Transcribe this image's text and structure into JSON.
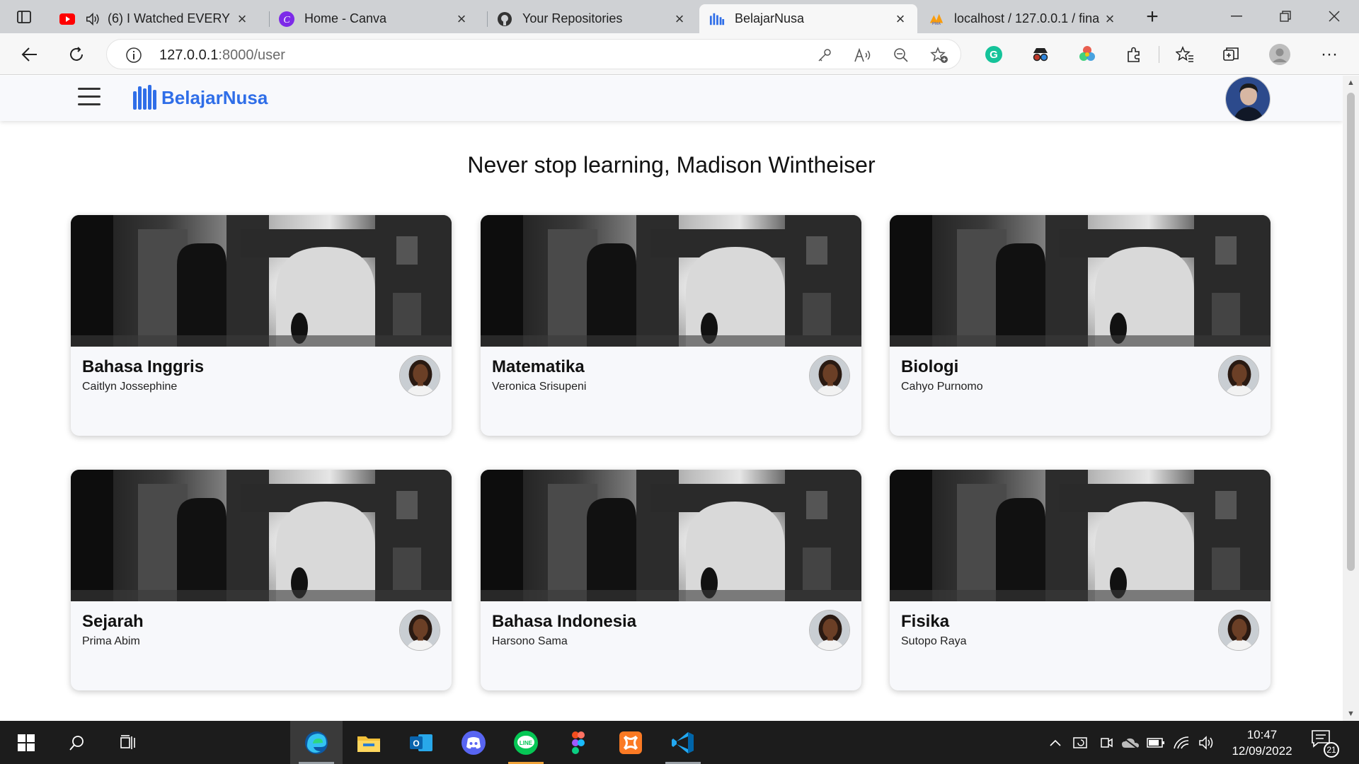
{
  "browser": {
    "tabs": [
      {
        "title": "(6) I Watched EVERY",
        "icon": "youtube-icon",
        "audio": true
      },
      {
        "title": "Home - Canva",
        "icon": "canva-icon"
      },
      {
        "title": "Your Repositories",
        "icon": "github-icon"
      },
      {
        "title": "BelajarNusa",
        "icon": "belajarnusa-icon",
        "active": true
      },
      {
        "title": "localhost / 127.0.0.1 / fina",
        "icon": "phpmyadmin-icon"
      }
    ],
    "url_host": "127.0.0.1",
    "url_rest": ":8000/user"
  },
  "navbar": {
    "brand": "BelajarNusa",
    "brand_color": "#2f6ee8"
  },
  "greeting": "Never stop learning, Madison Wintheiser",
  "courses": [
    {
      "title": "Bahasa Inggris",
      "teacher": "Caitlyn Jossephine"
    },
    {
      "title": "Matematika",
      "teacher": "Veronica Srisupeni"
    },
    {
      "title": "Biologi",
      "teacher": "Cahyo Purnomo"
    },
    {
      "title": "Sejarah",
      "teacher": "Prima Abim"
    },
    {
      "title": "Bahasa Indonesia",
      "teacher": "Harsono Sama"
    },
    {
      "title": "Fisika",
      "teacher": "Sutopo Raya"
    }
  ],
  "taskbar": {
    "time": "10:47",
    "date": "12/09/2022",
    "notifications": "21"
  }
}
